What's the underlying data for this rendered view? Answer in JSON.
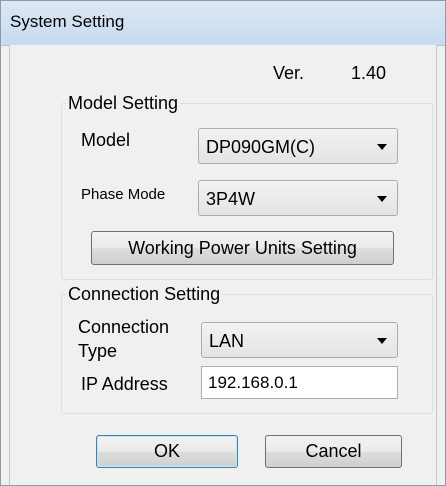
{
  "window": {
    "title": "System Setting"
  },
  "version": {
    "label": "Ver.",
    "value": "1.40"
  },
  "model_setting": {
    "legend": "Model Setting",
    "model_label": "Model",
    "model_value": "DP090GM(C)",
    "phase_label": "Phase Mode",
    "phase_value": "3P4W",
    "power_units_button": "Working Power Units Setting"
  },
  "connection_setting": {
    "legend": "Connection Setting",
    "type_label_line1": "Connection",
    "type_label_line2": "Type",
    "type_value": "LAN",
    "ip_label": "IP Address",
    "ip_value": "192.168.0.1"
  },
  "buttons": {
    "ok": "OK",
    "cancel": "Cancel"
  },
  "colors": {
    "titlebar": "#c9daef",
    "dialog_bg": "#f0f0f0",
    "default_button_border": "#3c7fb1"
  },
  "icons": [
    "chevron-down-icon"
  ]
}
